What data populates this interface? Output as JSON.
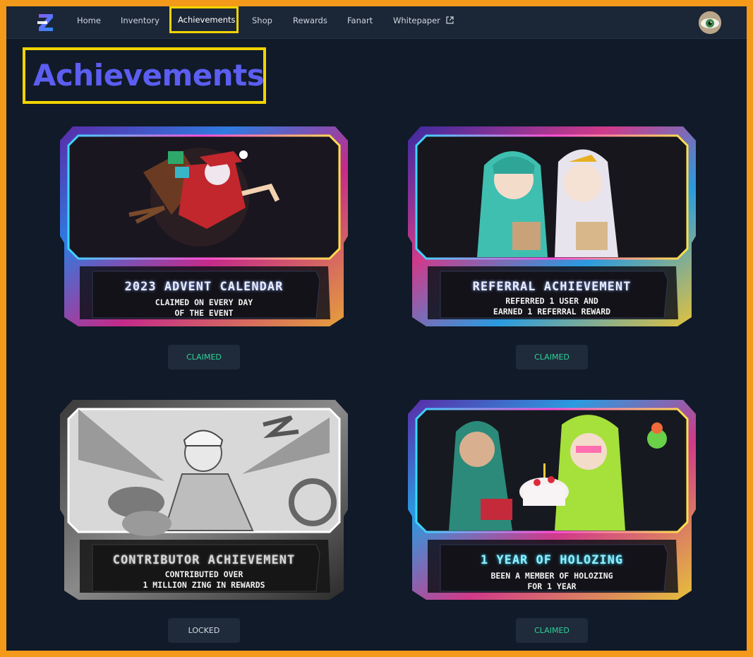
{
  "nav": {
    "items": [
      {
        "label": "Home"
      },
      {
        "label": "Inventory"
      },
      {
        "label": "Achievements"
      },
      {
        "label": "Shop"
      },
      {
        "label": "Rewards"
      },
      {
        "label": "Fanart"
      },
      {
        "label": "Whitepaper"
      }
    ],
    "active": "Achievements"
  },
  "page": {
    "title": "Achievements"
  },
  "achievements": [
    {
      "title": "2023 ADVENT CALENDAR",
      "desc_line1": "CLAIMED ON EVERY DAY",
      "desc_line2": "OF THE EVENT",
      "status": "CLAIMED",
      "art": "santa-character"
    },
    {
      "title": "REFERRAL ACHIEVEMENT",
      "desc_line1": "REFERRED 1 USER AND",
      "desc_line2": "EARNED 1 REFERRAL REWARD",
      "status": "CLAIMED",
      "art": "two-characters"
    },
    {
      "title": "CONTRIBUTOR ACHIEVEMENT",
      "desc_line1": "CONTRIBUTED OVER",
      "desc_line2": "1 MILLION ZING IN REWARDS",
      "status": "LOCKED",
      "art": "greyscale-character"
    },
    {
      "title": "1 YEAR OF HOLOZING",
      "desc_line1": "BEEN A MEMBER OF HOLOZING",
      "desc_line2": "FOR 1 YEAR",
      "status": "CLAIMED",
      "art": "birthday-cake-characters"
    }
  ],
  "colors": {
    "accent": "#5b5ef0",
    "highlight": "#f2d400",
    "claimed": "#2ed39a",
    "background": "#111a28",
    "nav": "#1b2636"
  }
}
